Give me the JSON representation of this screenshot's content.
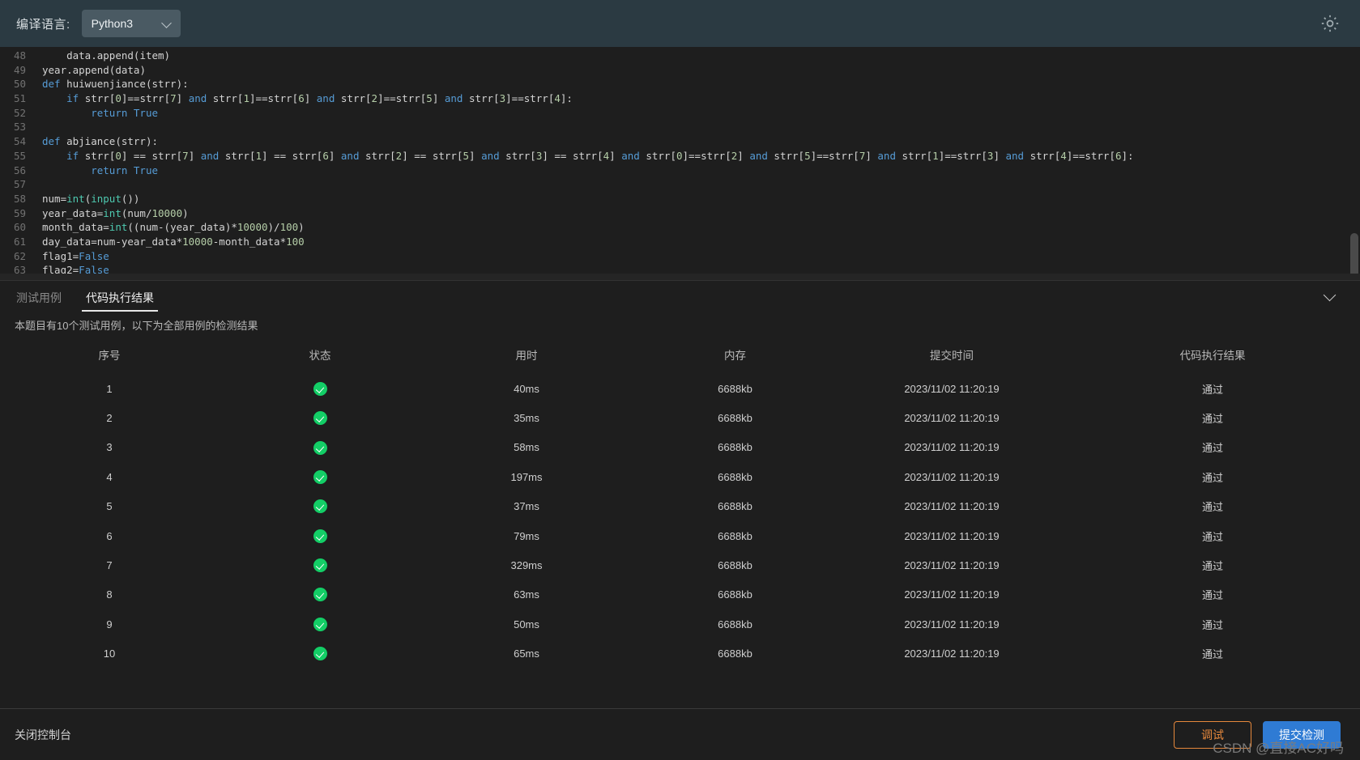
{
  "topbar": {
    "label": "编译语言:",
    "language_value": "Python3",
    "chevron_icon": "chevron-down-icon",
    "settings_icon": "gear-icon"
  },
  "editor": {
    "lines": [
      {
        "no": "48",
        "indent": 2,
        "text": "    data.append(item)"
      },
      {
        "no": "49",
        "indent": 0,
        "text": "year.append(data)"
      },
      {
        "no": "50",
        "indent": 0,
        "text": "def huiwuenjiance(strr):"
      },
      {
        "no": "51",
        "indent": 1,
        "text": "    if strr[0]==strr[7] and strr[1]==strr[6] and strr[2]==strr[5] and strr[3]==strr[4]:"
      },
      {
        "no": "52",
        "indent": 3,
        "text": "        return True"
      },
      {
        "no": "53",
        "indent": 0,
        "text": ""
      },
      {
        "no": "54",
        "indent": 0,
        "text": "def abjiance(strr):"
      },
      {
        "no": "55",
        "indent": 1,
        "text": "    if strr[0] == strr[7] and strr[1] == strr[6] and strr[2] == strr[5] and strr[3] == strr[4] and strr[0]==strr[2] and strr[5]==strr[7] and strr[1]==strr[3] and strr[4]==strr[6]:"
      },
      {
        "no": "56",
        "indent": 3,
        "text": "        return True"
      },
      {
        "no": "57",
        "indent": 0,
        "text": ""
      },
      {
        "no": "58",
        "indent": 0,
        "text": "num=int(input())"
      },
      {
        "no": "59",
        "indent": 0,
        "text": "year_data=int(num/10000)"
      },
      {
        "no": "60",
        "indent": 0,
        "text": "month_data=int((num-(year_data)*10000)/100)"
      },
      {
        "no": "61",
        "indent": 0,
        "text": "day_data=num-year_data*10000-month_data*100"
      },
      {
        "no": "62",
        "indent": 0,
        "text": "flag1=False"
      },
      {
        "no": "63",
        "indent": 0,
        "text": "flag2=False"
      }
    ]
  },
  "console": {
    "tabs": [
      {
        "label": "测试用例",
        "active": false
      },
      {
        "label": "代码执行结果",
        "active": true
      }
    ],
    "collapse_icon": "chevron-down-icon",
    "info": "本题目有10个测试用例，以下为全部用例的检测结果",
    "columns": [
      "序号",
      "状态",
      "用时",
      "内存",
      "提交时间",
      "代码执行结果"
    ],
    "rows": [
      {
        "index": "1",
        "status": "pass-check-icon",
        "time": "40ms",
        "memory": "6688kb",
        "submitted": "2023/11/02 11:20:19",
        "result": "通过"
      },
      {
        "index": "2",
        "status": "pass-check-icon",
        "time": "35ms",
        "memory": "6688kb",
        "submitted": "2023/11/02 11:20:19",
        "result": "通过"
      },
      {
        "index": "3",
        "status": "pass-check-icon",
        "time": "58ms",
        "memory": "6688kb",
        "submitted": "2023/11/02 11:20:19",
        "result": "通过"
      },
      {
        "index": "4",
        "status": "pass-check-icon",
        "time": "197ms",
        "memory": "6688kb",
        "submitted": "2023/11/02 11:20:19",
        "result": "通过"
      },
      {
        "index": "5",
        "status": "pass-check-icon",
        "time": "37ms",
        "memory": "6688kb",
        "submitted": "2023/11/02 11:20:19",
        "result": "通过"
      },
      {
        "index": "6",
        "status": "pass-check-icon",
        "time": "79ms",
        "memory": "6688kb",
        "submitted": "2023/11/02 11:20:19",
        "result": "通过"
      },
      {
        "index": "7",
        "status": "pass-check-icon",
        "time": "329ms",
        "memory": "6688kb",
        "submitted": "2023/11/02 11:20:19",
        "result": "通过"
      },
      {
        "index": "8",
        "status": "pass-check-icon",
        "time": "63ms",
        "memory": "6688kb",
        "submitted": "2023/11/02 11:20:19",
        "result": "通过"
      },
      {
        "index": "9",
        "status": "pass-check-icon",
        "time": "50ms",
        "memory": "6688kb",
        "submitted": "2023/11/02 11:20:19",
        "result": "通过"
      },
      {
        "index": "10",
        "status": "pass-check-icon",
        "time": "65ms",
        "memory": "6688kb",
        "submitted": "2023/11/02 11:20:19",
        "result": "通过"
      }
    ]
  },
  "bottombar": {
    "close_console": "关闭控制台",
    "debug_label": "调试",
    "submit_label": "提交检测",
    "watermark": "CSDN @直接AC好吗"
  },
  "colors": {
    "accent_blue": "#2f7bd4",
    "debug_orange": "#e6883c",
    "pass_green": "#13ce66",
    "topbar_bg": "#2b3a42",
    "editor_bg": "#1e1e1e"
  }
}
